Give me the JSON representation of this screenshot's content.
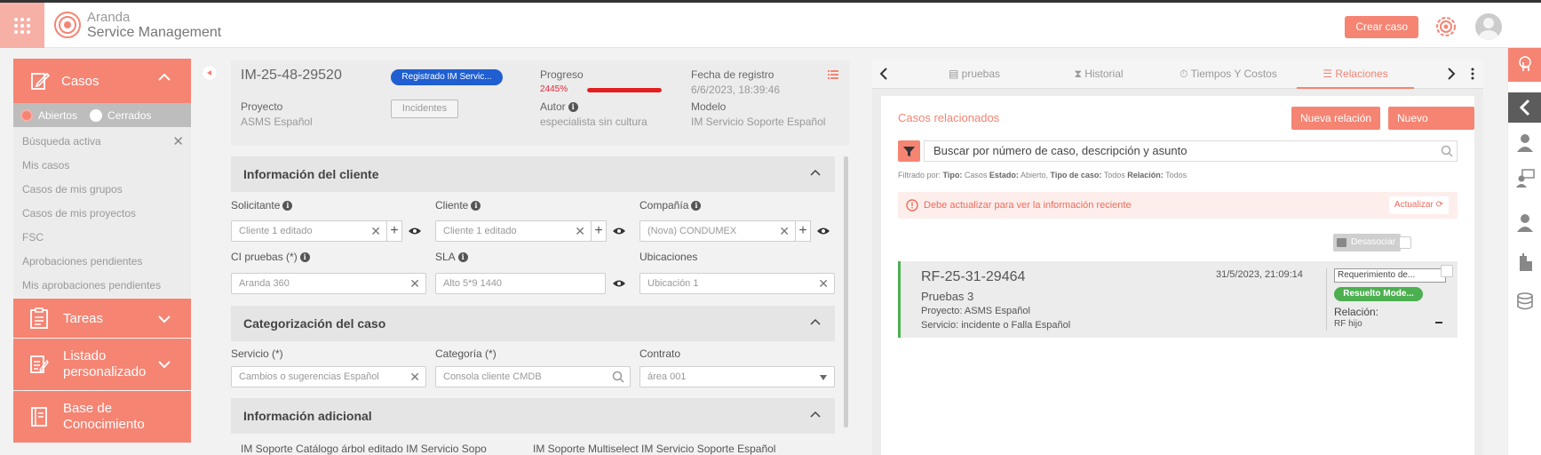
{
  "header": {
    "brand_line1": "Aranda",
    "brand_line2": "Service Management",
    "create_case": "Crear caso",
    "apps_icon": "grid-icon",
    "settings_icon": "gear-icon",
    "avatar_icon": "user-avatar"
  },
  "sidebar": {
    "casos": "Casos",
    "opt_open": "Abiertos",
    "opt_closed": "Cerrados",
    "items": [
      {
        "label": "Búsqueda activa"
      },
      {
        "label": "Mis casos"
      },
      {
        "label": "Casos de mis grupos"
      },
      {
        "label": "Casos de mis proyectos"
      },
      {
        "label": "FSC"
      },
      {
        "label": "Aprobaciones pendientes"
      },
      {
        "label": "Mis aprobaciones pendientes"
      }
    ],
    "tareas": "Tareas",
    "listado_1": "Listado",
    "listado_2": "personalizado",
    "base_1": "Base de",
    "base_2": "Conocimiento"
  },
  "case": {
    "id": "IM-25-48-29520",
    "state": "Registrado IM Servic...",
    "type_button": "Incidentes",
    "progress_label": "Progreso",
    "progress_value": "2445%",
    "progress_fraction": 1.0,
    "date_label": "Fecha de registro",
    "date_value": "6/6/2023, 18:39:46",
    "project_label": "Proyecto",
    "project_value": "ASMS Español",
    "author_label": "Autor",
    "author_value": "especialista sin cultura",
    "model_label": "Modelo",
    "model_value": "IM Servicio Soporte Español"
  },
  "client_section": {
    "title": "Información del cliente",
    "solicitante_label": "Solicitante",
    "solicitante_value": "Cliente 1 editado",
    "cliente_label": "Cliente",
    "cliente_value": "Cliente 1 editado",
    "compania_label": "Compañía",
    "compania_value": "(Nova) CONDUMEX",
    "ci_label": "CI pruebas (*)",
    "ci_value": "Aranda 360",
    "sla_label": "SLA",
    "sla_value": "Alto 5*9 1440",
    "ubic_label": "Ubicaciones",
    "ubic_value": "Ubicación 1"
  },
  "category_section": {
    "title": "Categorización del caso",
    "servicio_label": "Servicio (*)",
    "servicio_value": "Cambios o sugerencias  Español",
    "categoria_label": "Categoría (*)",
    "categoria_value": "Consola cliente CMDB",
    "contrato_label": "Contrato",
    "contrato_value": "área 001"
  },
  "additional_section": {
    "title": "Información adicional",
    "field1": "IM Soporte Catálogo árbol editado IM Servicio Sopo",
    "field2": "IM Soporte Multiselect IM Servicio Soporte Español"
  },
  "right_panel": {
    "tabs": [
      {
        "label": "pruebas"
      },
      {
        "label": "Historial"
      },
      {
        "label": "Tiempos Y Costos"
      },
      {
        "label": "Relaciones"
      }
    ],
    "title": "Casos relacionados",
    "new_relation": "Nueva relación",
    "new_article": "Nuevo artículo",
    "search_placeholder": "Buscar por número de caso, descripción y asunto",
    "filter_prefix": "Filtrado por:",
    "f_tipo_k": "Tipo:",
    "f_tipo_v": "Casos",
    "f_estado_k": "Estado:",
    "f_estado_v": "Abierto,",
    "f_tipocaso_k": "Tipo de caso:",
    "f_tipocaso_v": "Todos",
    "f_rel_k": "Relación:",
    "f_rel_v": "Todos",
    "alert_msg": "Debe actualizar para ver la información reciente",
    "alert_action": "Actualizar",
    "unlink": "Desasociar",
    "related": {
      "id": "RF-25-31-29464",
      "date": "31/5/2023, 21:09:14",
      "subject": "Pruebas 3",
      "project": "Proyecto: ASMS Español",
      "service": "Servicio: incidente o Falla Español",
      "type": "Requerimiento de...",
      "resolution": "Resuelto Mode...",
      "rel_label": "Relación:",
      "rel_value": "RF hijo"
    }
  },
  "colors": {
    "accent": "#f58473",
    "badge_blue": "#1f5fd1",
    "success": "#4caf50"
  }
}
